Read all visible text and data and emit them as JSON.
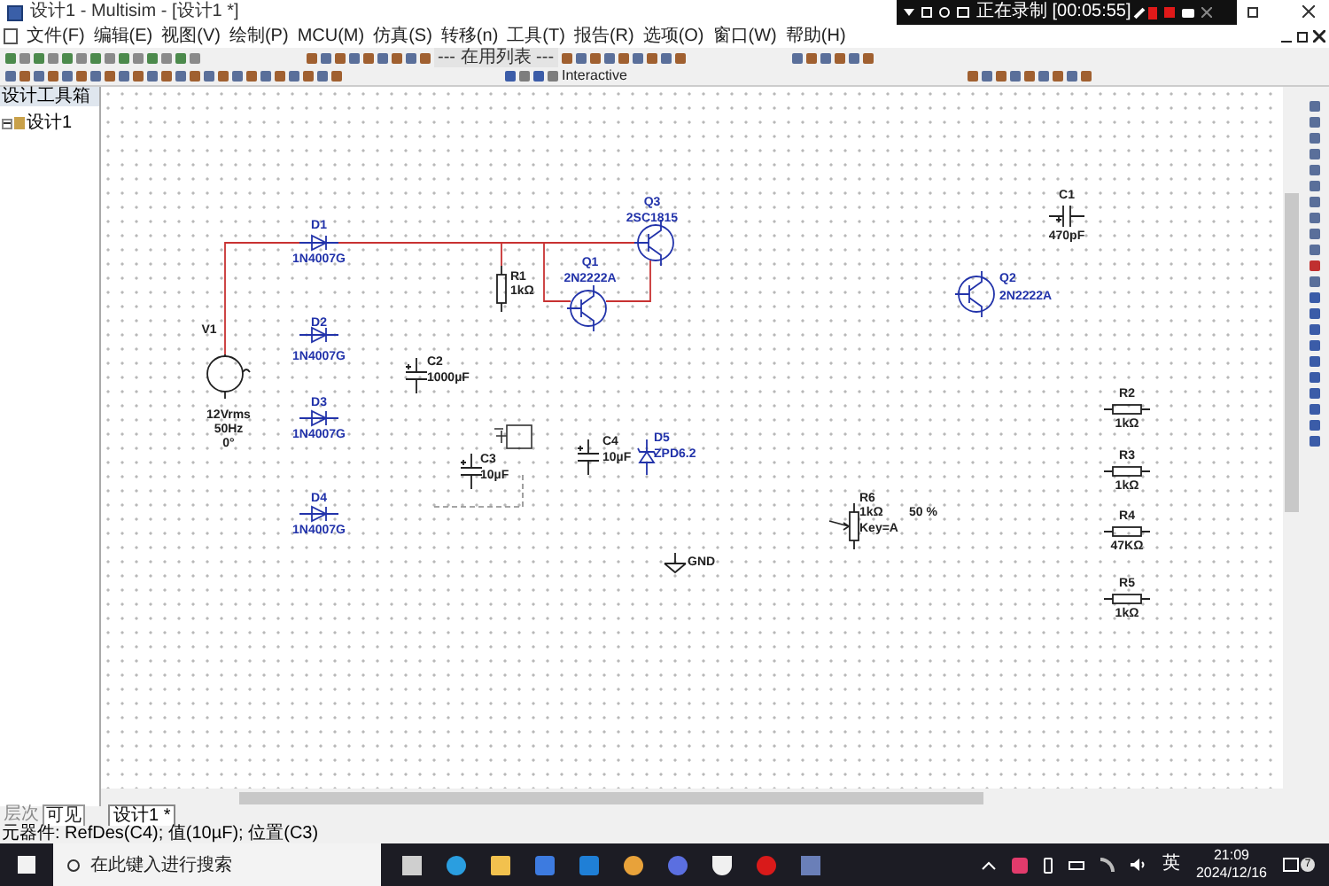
{
  "window": {
    "title": "设计1 - Multisim - [设计1 *]"
  },
  "recorder": {
    "status": "正在录制 [00:05:55]"
  },
  "menu": [
    "文件(F)",
    "编辑(E)",
    "视图(V)",
    "绘制(P)",
    "MCU(M)",
    "仿真(S)",
    "转移(n)",
    "工具(T)",
    "报告(R)",
    "选项(O)",
    "窗口(W)",
    "帮助(H)"
  ],
  "toolbar": {
    "in_use_list": "--- 在用列表 ---",
    "mode": "Interactive"
  },
  "design_toolbox": {
    "title": "设计工具箱",
    "tree": [
      {
        "label": "设计1",
        "expanded": true
      }
    ],
    "tabs": [
      {
        "label": "层次",
        "selected": false
      },
      {
        "label": "可见",
        "selected": true
      }
    ]
  },
  "components": [
    {
      "kind": "source",
      "ref": "V1",
      "lines": [
        "12Vrms",
        "50Hz",
        "0°"
      ]
    },
    {
      "kind": "diode",
      "ref": "D1",
      "value": "1N4007G"
    },
    {
      "kind": "diode",
      "ref": "D2",
      "value": "1N4007G"
    },
    {
      "kind": "diode",
      "ref": "D3",
      "value": "1N4007G"
    },
    {
      "kind": "diode",
      "ref": "D4",
      "value": "1N4007G"
    },
    {
      "kind": "resistor",
      "ref": "R1",
      "value": "1kΩ"
    },
    {
      "kind": "bjt",
      "ref": "Q1",
      "value": "2N2222A"
    },
    {
      "kind": "bjt",
      "ref": "Q3",
      "value": "2SC1815"
    },
    {
      "kind": "capacitor",
      "ref": "C2",
      "value": "1000µF"
    },
    {
      "kind": "capacitor",
      "ref": "C3",
      "value": "10µF"
    },
    {
      "kind": "capacitor",
      "ref": "C4",
      "value": "10µF"
    },
    {
      "kind": "zener",
      "ref": "D5",
      "value": "ZPD6.2"
    },
    {
      "kind": "ground",
      "ref": "GND"
    },
    {
      "kind": "potentiometer",
      "ref": "R6",
      "value": "1kΩ",
      "key": "Key=A",
      "setting": "50 %"
    },
    {
      "kind": "capacitor",
      "ref": "C1",
      "value": "470pF"
    },
    {
      "kind": "bjt",
      "ref": "Q2",
      "value": "2N2222A"
    },
    {
      "kind": "resistor",
      "ref": "R2",
      "value": "1kΩ"
    },
    {
      "kind": "resistor",
      "ref": "R3",
      "value": "1kΩ"
    },
    {
      "kind": "resistor",
      "ref": "R4",
      "value": "47KΩ"
    },
    {
      "kind": "resistor",
      "ref": "R5",
      "value": "1kΩ"
    }
  ],
  "document_tabs": [
    {
      "label": "设计1 *",
      "selected": true
    }
  ],
  "status_bar": "元器件: RefDes(C4); 值(10µF); 位置(C3)",
  "taskbar": {
    "search": {
      "placeholder": "在此键入进行搜索"
    },
    "input_method": "英",
    "time": "21:09",
    "date": "2024/12/16",
    "notifications": "7"
  }
}
